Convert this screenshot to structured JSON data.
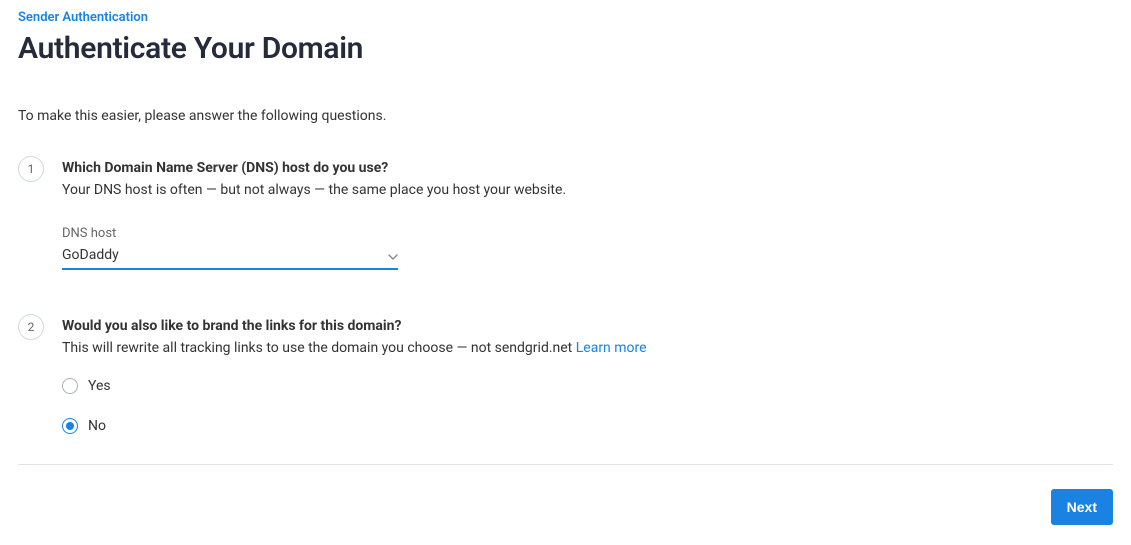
{
  "breadcrumb": "Sender Authentication",
  "page_title": "Authenticate Your Domain",
  "intro": "To make this easier, please answer the following questions.",
  "steps": {
    "one": {
      "num": "1",
      "question": "Which Domain Name Server (DNS) host do you use?",
      "help": "Your DNS host is often — but not always — the same place you host your website.",
      "field_label": "DNS host",
      "selected": "GoDaddy"
    },
    "two": {
      "num": "2",
      "question": "Would you also like to brand the links for this domain?",
      "help": "This will rewrite all tracking links to use the domain you choose — not sendgrid.net ",
      "learn_more": "Learn more",
      "options": {
        "yes": "Yes",
        "no": "No"
      }
    }
  },
  "next_label": "Next"
}
